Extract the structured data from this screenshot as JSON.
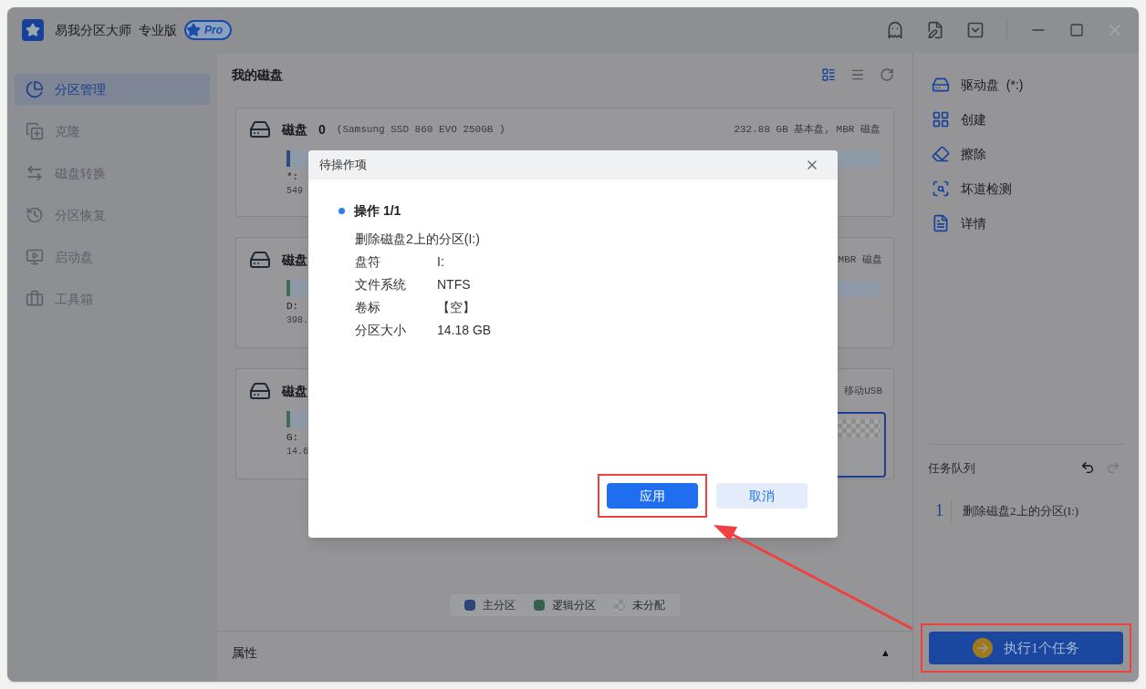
{
  "window": {
    "app_name": "易我分区大师",
    "edition": "专业版",
    "badge": "Pro"
  },
  "sidebar": {
    "items": [
      {
        "label": "分区管理",
        "selected": true,
        "disabled": false
      },
      {
        "label": "克隆",
        "selected": false,
        "disabled": true
      },
      {
        "label": "磁盘转换",
        "selected": false,
        "disabled": true
      },
      {
        "label": "分区恢复",
        "selected": false,
        "disabled": true
      },
      {
        "label": "启动盘",
        "selected": false,
        "disabled": true
      },
      {
        "label": "工具箱",
        "selected": false,
        "disabled": true
      }
    ]
  },
  "main": {
    "title": "我的磁盘",
    "disks": [
      {
        "name": "磁盘",
        "number": "0",
        "model": "(Samsung SSD 860 EVO 250GB )",
        "info": "232.88 GB 基本盘, MBR 磁盘",
        "partition_label": "*:",
        "partition_size": "549",
        "color": "#2c4a7d",
        "selected": false
      },
      {
        "name": "磁盘",
        "info": "MBR 磁盘",
        "partition_label": "D:",
        "partition_size": "398.",
        "color": "#436a56",
        "selected": false
      },
      {
        "name": "磁盘",
        "info": "移动USB",
        "partition_label": "G:",
        "partition_size": "14.6",
        "color": "#436a56",
        "selected": true
      }
    ],
    "legend": [
      {
        "label": "主分区",
        "kind": "color",
        "color": "#2c4476"
      },
      {
        "label": "逻辑分区",
        "kind": "color",
        "color": "#36604c"
      },
      {
        "label": "未分配",
        "kind": "checker"
      }
    ],
    "properties": {
      "label": "属性",
      "toggle": "▲"
    }
  },
  "right_panel": {
    "actions": [
      {
        "label": "驱动盘  (*:)",
        "kind": "drive"
      },
      {
        "label": "创建",
        "kind": "create"
      },
      {
        "label": "擦除",
        "kind": "erase"
      },
      {
        "label": "坏道检测",
        "kind": "scan"
      },
      {
        "label": "详情",
        "kind": "details"
      }
    ],
    "task_queue": {
      "title": "任务队列",
      "tasks": [
        {
          "number": "1",
          "text": "删除磁盘2上的分区(I:)"
        }
      ]
    },
    "execute_button": {
      "label": "执行1个任务",
      "highlighted": true
    }
  },
  "dialog": {
    "title": "待操作项",
    "operation": "操作 1/1",
    "description": "删除磁盘2上的分区(I:)",
    "fields": [
      {
        "label": "盘符",
        "value": "I:"
      },
      {
        "label": "文件系统",
        "value": "NTFS"
      },
      {
        "label": "卷标",
        "value": "【空】"
      },
      {
        "label": "分区大小",
        "value": "14.18 GB"
      }
    ],
    "buttons": [
      {
        "label": "应用",
        "kind": "primary",
        "highlighted": true
      },
      {
        "label": "取消",
        "kind": "secondary",
        "highlighted": false
      }
    ]
  }
}
